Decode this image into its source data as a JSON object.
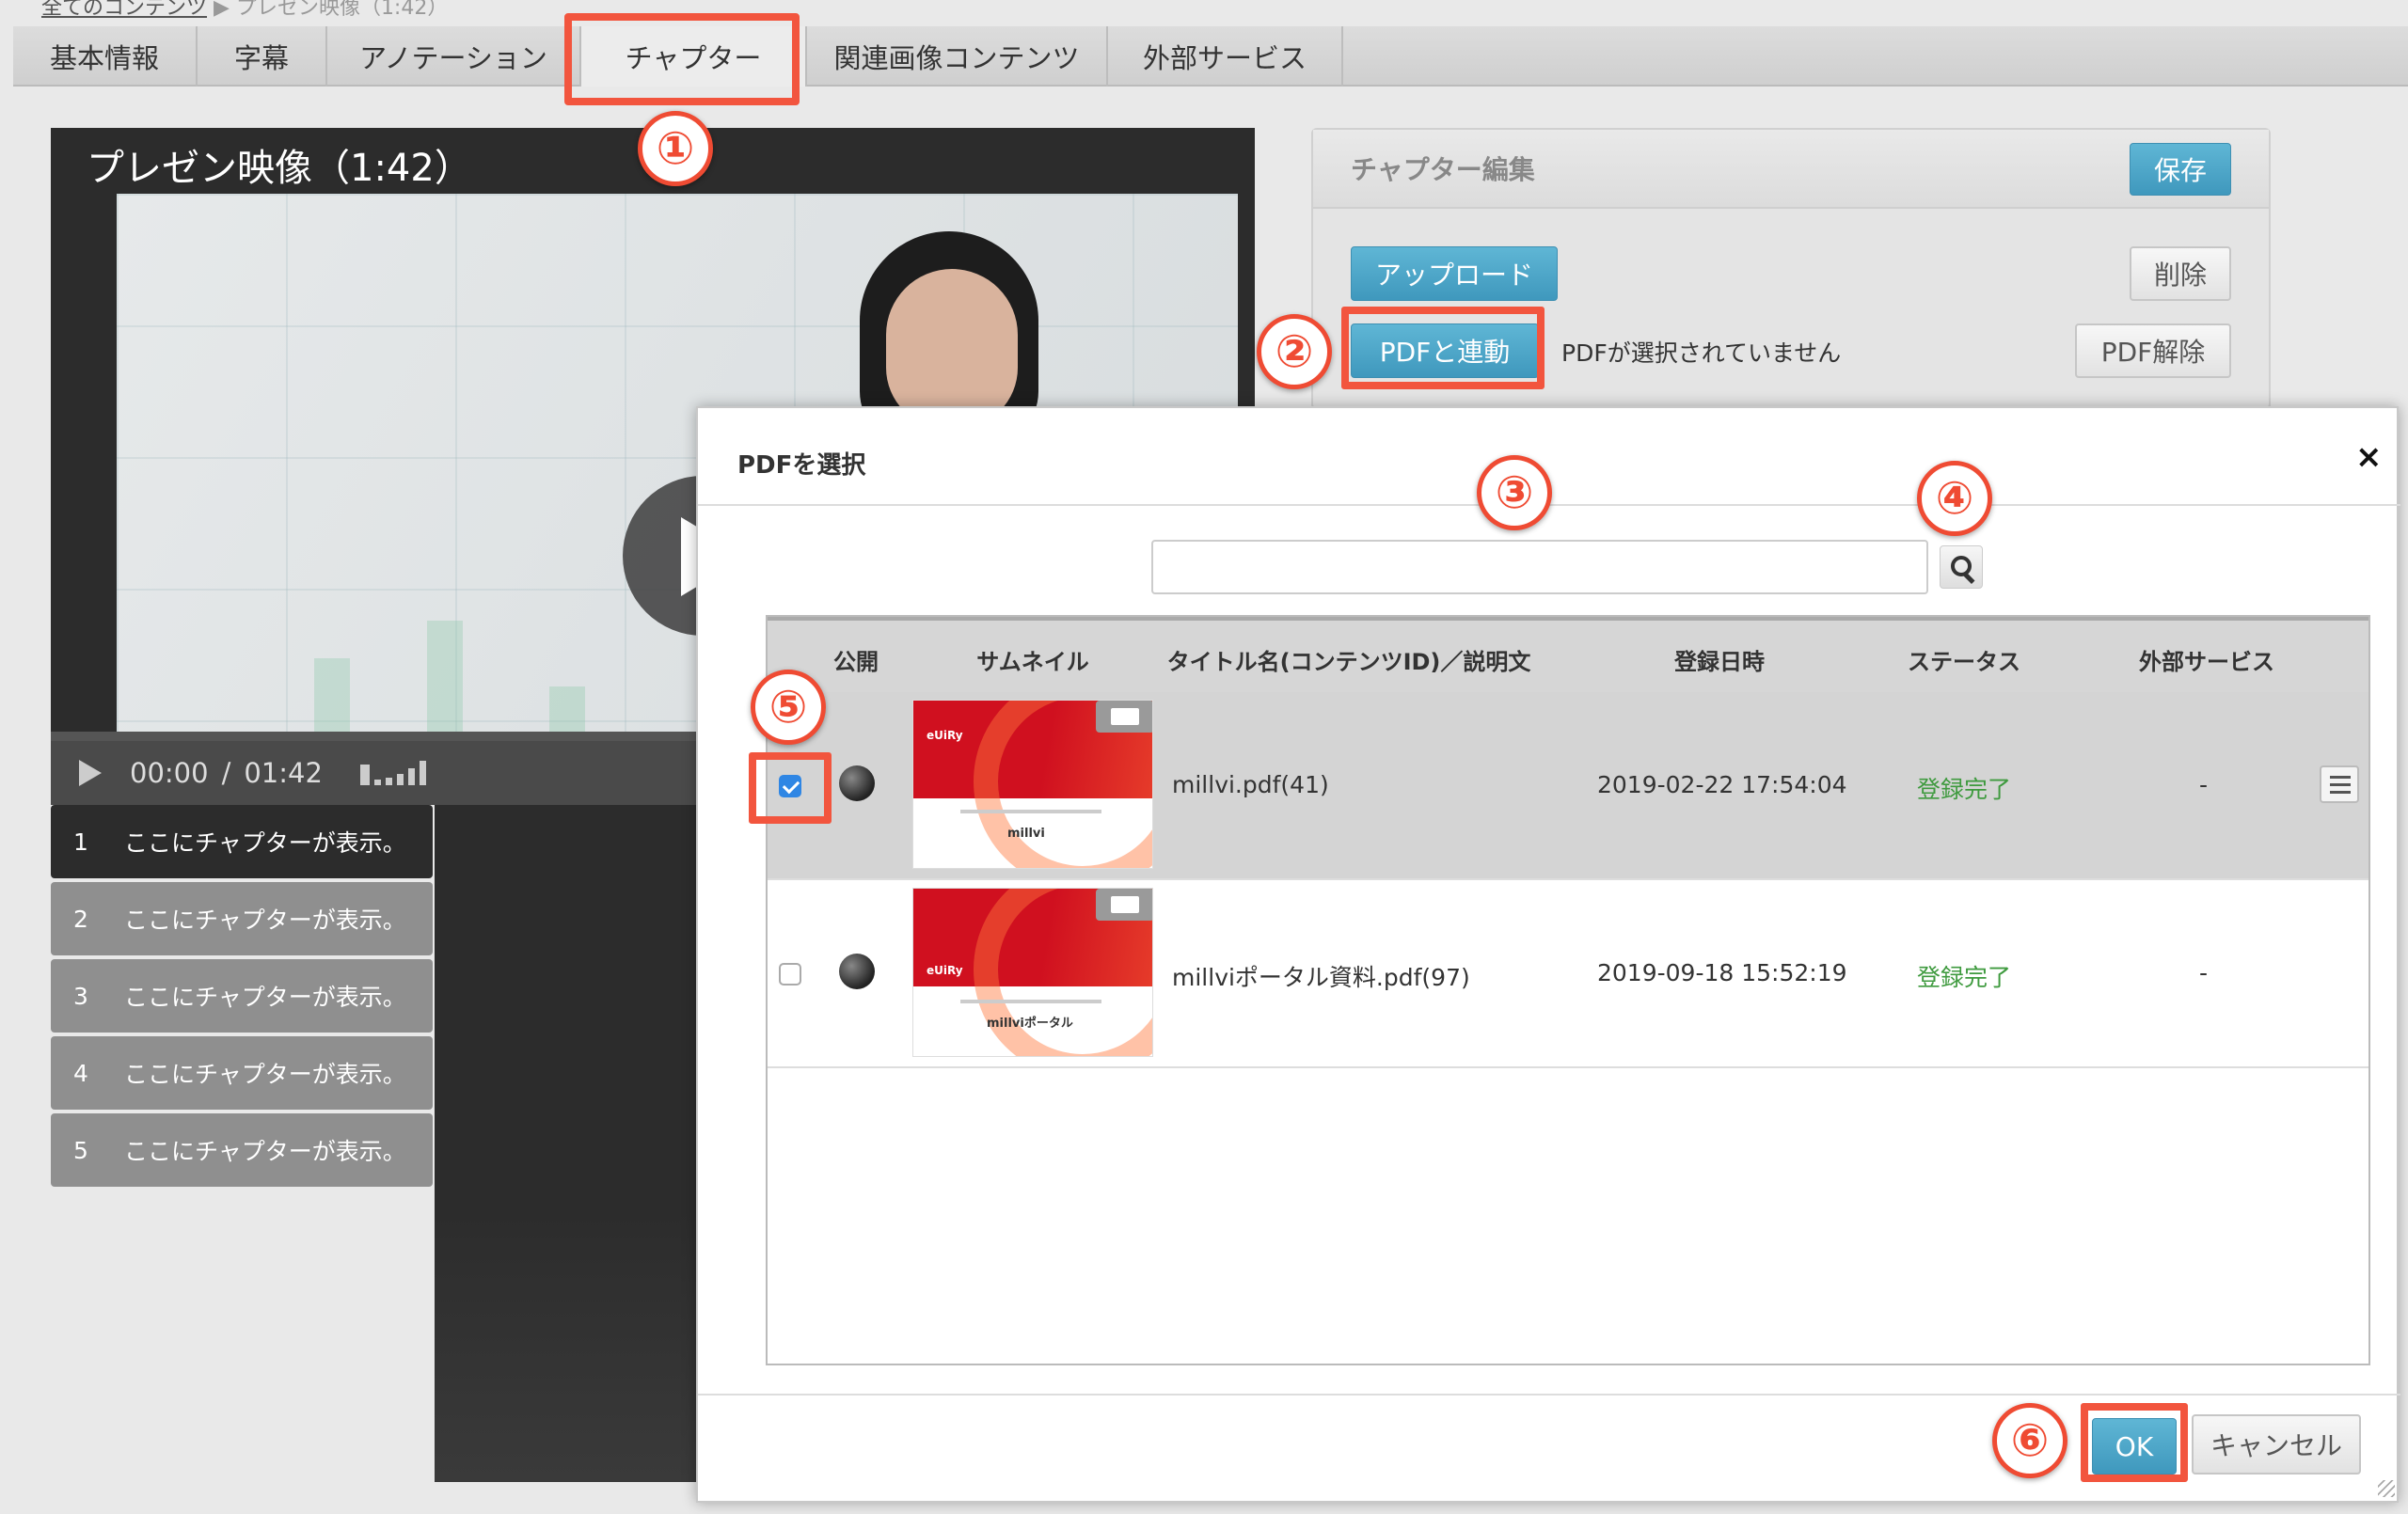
{
  "breadcrumb": {
    "root": "全てのコンテンツ",
    "separator": "▶",
    "current": "プレゼン映像（1:42）"
  },
  "tabs": [
    "基本情報",
    "字幕",
    "アノテーション",
    "チャプター",
    "関連画像コンテンツ",
    "外部サービス"
  ],
  "active_tab": "チャプター",
  "steps": [
    "①",
    "②",
    "③",
    "④",
    "⑤",
    "⑥"
  ],
  "player": {
    "title": "プレゼン映像（1:42）",
    "current_time": "00:00",
    "time_separator": "/",
    "duration": "01:42",
    "progress": 0
  },
  "chapters": [
    {
      "num": "1",
      "label": "ここにチャプターが表示。"
    },
    {
      "num": "2",
      "label": "ここにチャプターが表示。"
    },
    {
      "num": "3",
      "label": "ここにチャプターが表示。"
    },
    {
      "num": "4",
      "label": "ここにチャプターが表示。"
    },
    {
      "num": "5",
      "label": "ここにチャプターが表示。"
    }
  ],
  "edit_panel": {
    "title": "チャプター編集",
    "save": "保存",
    "upload": "アップロード",
    "delete": "削除",
    "pdf_link": "PDFと連動",
    "pdf_status": "PDFが選択されていません",
    "pdf_unlink": "PDF解除"
  },
  "modal": {
    "title": "PDFを選択",
    "close": "×",
    "search": {
      "value": "",
      "placeholder": ""
    },
    "columns": [
      "公開",
      "サムネイル",
      "タイトル名(コンテンツID)／説明文",
      "登録日時",
      "ステータス",
      "外部サービス"
    ],
    "rows": [
      {
        "checked": true,
        "title": "millvi.pdf(41)",
        "date": "2019-02-22 17:54:04",
        "status": "登録完了",
        "external": "-",
        "thumb_brand": "millvi",
        "thumb_logo": "eUiRy"
      },
      {
        "checked": false,
        "title": "millviポータル資料.pdf(97)",
        "date": "2019-09-18 15:52:19",
        "status": "登録完了",
        "external": "-",
        "thumb_brand": "millviポータル",
        "thumb_logo": "eUiRy"
      }
    ],
    "ok": "OK",
    "cancel": "キャンセル"
  },
  "colors": {
    "accent": "#f2553e",
    "button_blue": "#3f98bd",
    "status_ok": "#3e9a3e",
    "checkbox": "#2f86e4"
  }
}
